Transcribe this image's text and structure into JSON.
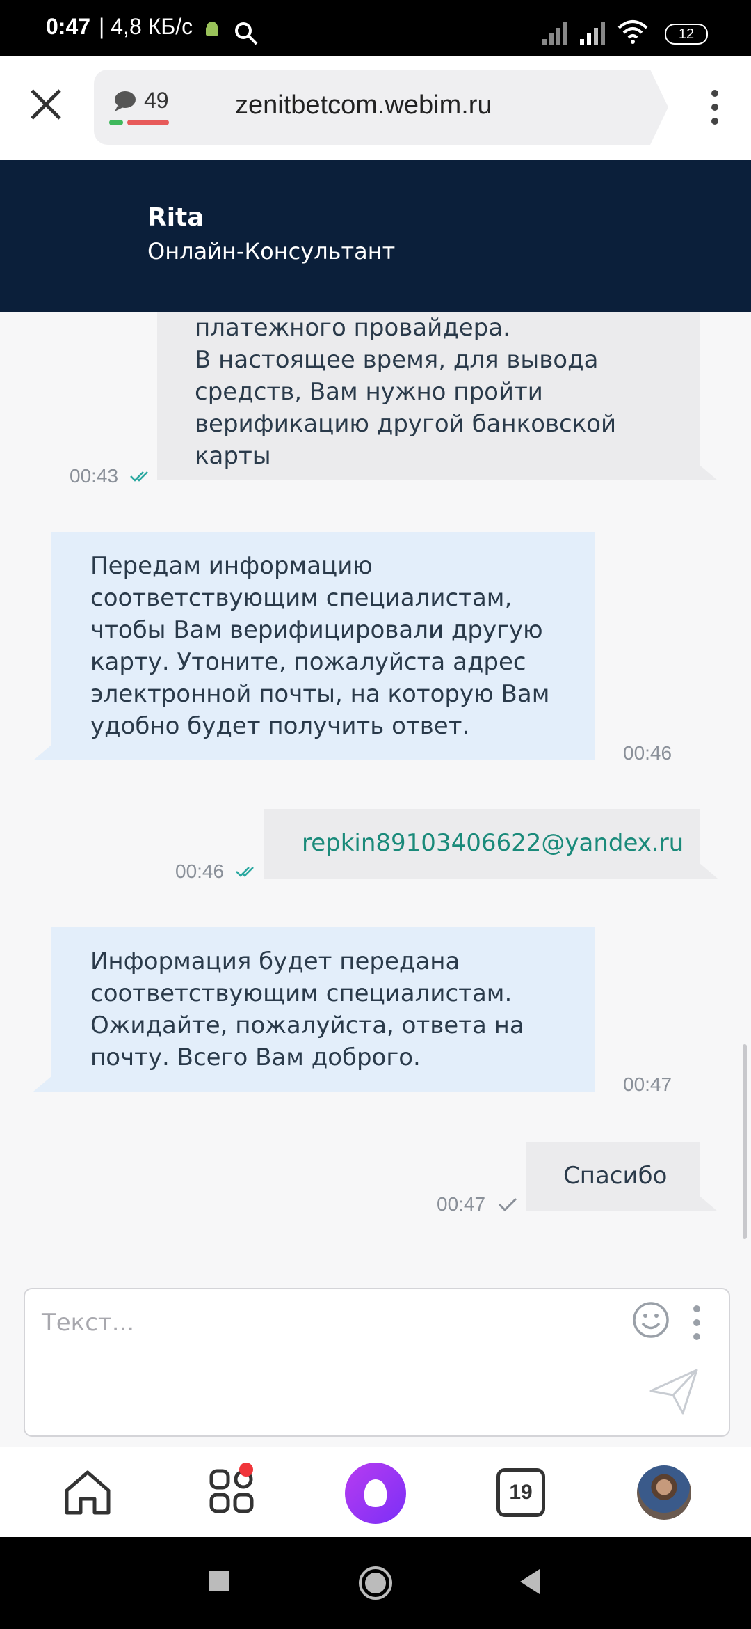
{
  "status_bar": {
    "time": "0:47",
    "net_speed": "| 4,8 КБ/с",
    "battery": "12"
  },
  "browser": {
    "tab_count": "49",
    "url": "zenitbetcom.webim.ru"
  },
  "chat_header": {
    "agent_name": "Rita",
    "agent_role": "Онлайн-Консультант"
  },
  "messages": [
    {
      "direction": "out",
      "lines": [
        "платежного провайдера.",
        "В настоящее время, для вывода",
        "средств, Вам нужно пройти",
        "верификацию другой банковской",
        "карты"
      ],
      "time": "00:43",
      "status": "read"
    },
    {
      "direction": "in",
      "lines": [
        "Передам информацию",
        "соответствующим специалистам,",
        "чтобы Вам верифицировали другую",
        "карту. Утоните, пожалуйста адрес",
        "электронной почты, на которую Вам",
        "удобно будет получить ответ."
      ],
      "time": "00:46"
    },
    {
      "direction": "out",
      "lines": [
        "repkin89103406622@yandex.ru"
      ],
      "time": "00:46",
      "status": "read"
    },
    {
      "direction": "in",
      "lines": [
        "Информация будет передана",
        "соответствующим специалистам.",
        "Ожидайте, пожалуйста, ответа на",
        "почту. Всего Вам доброго."
      ],
      "time": "00:47"
    },
    {
      "direction": "out",
      "lines": [
        "Спасибо"
      ],
      "time": "00:47",
      "status": "sent"
    }
  ],
  "input": {
    "placeholder": "Текст..."
  },
  "app_nav": {
    "tabs_count": "19"
  },
  "colors": {
    "header_bg": "#0b1f3a",
    "incoming_bubble": "#e3eefa",
    "outgoing_bubble": "#ebebed",
    "email_link": "#1a8a7a",
    "read_check": "#2aa8a0"
  }
}
